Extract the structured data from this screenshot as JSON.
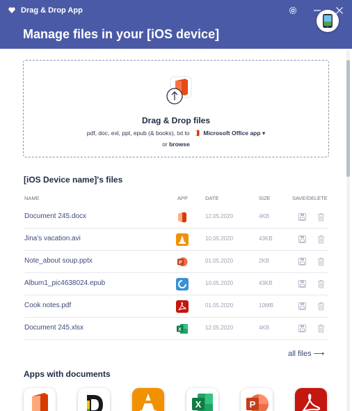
{
  "window": {
    "title": "Drag & Drop App",
    "icons": [
      "heart-icon",
      "gear-icon",
      "minimize-icon",
      "close-icon"
    ]
  },
  "header": {
    "title": "Manage files in your [iOS device]",
    "device_icon": "phone-icon"
  },
  "dropzone": {
    "title": "Drag & Drop files",
    "formats": "pdf, doc, exl, ppt, epub (& books), txt to",
    "target_app": "Microsoft Office app",
    "target_dropdown_icon": "caret-down-icon",
    "or_text": "or",
    "browse_label": "browse"
  },
  "files": {
    "title": "[iOS Device name]'s files",
    "columns": {
      "name": "NAME",
      "app": "APP",
      "date": "DATE",
      "size": "SIZE",
      "actions": "SAVE/DELETE"
    },
    "rows": [
      {
        "name": "Document 245.docx",
        "app": "office",
        "date": "12.05.2020",
        "size": "4KB"
      },
      {
        "name": "Jina's vacation.avi",
        "app": "vlc",
        "date": "10.05.2020",
        "size": "43KB"
      },
      {
        "name": "Note_about soup.pptx",
        "app": "powerpoint",
        "date": "01.05.2020",
        "size": "2KB"
      },
      {
        "name": "Album1_pic4638024.epub",
        "app": "reader",
        "date": "10.05.2020",
        "size": "43KB"
      },
      {
        "name": "Cook notes.pdf",
        "app": "acrobat",
        "date": "01.05.2020",
        "size": "10MB"
      },
      {
        "name": "Document 245.xlsx",
        "app": "excel",
        "date": "12.05.2020",
        "size": "4KB"
      }
    ],
    "all_files_label": "all files ⟶"
  },
  "apps": {
    "title": "Apps with documents",
    "items": [
      "office",
      "docs-d",
      "vlc",
      "excel",
      "powerpoint",
      "acrobat"
    ]
  },
  "colors": {
    "header": "#4b5aa7",
    "office": "#d83b01",
    "vlc": "#f29100",
    "powerpoint": "#d24726",
    "excel": "#1f7244",
    "acrobat": "#c4170f",
    "reader": "#3a8fd6"
  }
}
